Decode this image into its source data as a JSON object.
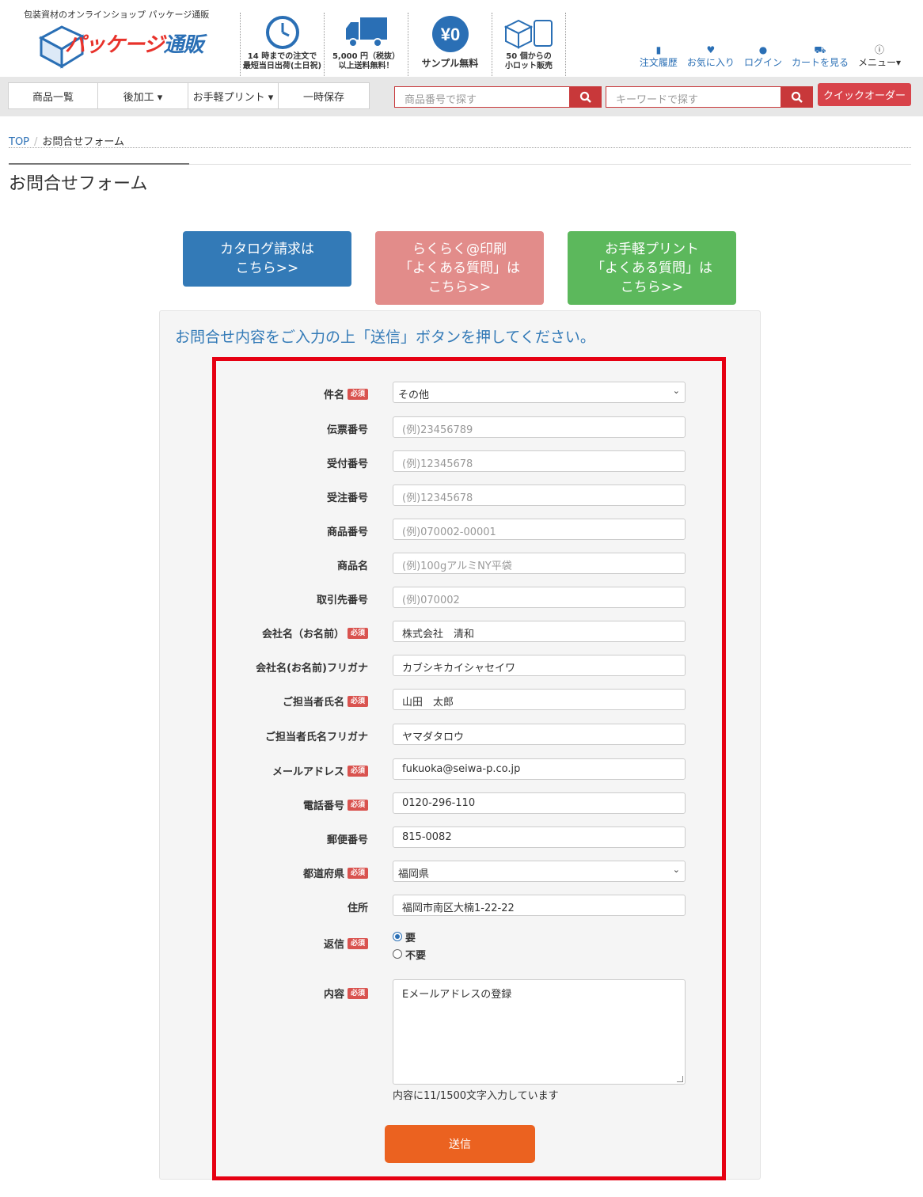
{
  "header": {
    "tagline": "包装資材のオンラインショップ パッケージ通販",
    "logo_text_a": "パッケージ",
    "logo_text_b": "通販",
    "features": [
      {
        "icon": "clock-icon",
        "caption_1": "14 時までの注文で",
        "caption_2": "最短当日出荷(土日祝)"
      },
      {
        "icon": "truck-icon",
        "caption_1": "5,000 円（税抜）",
        "caption_2": "以上送料無料！"
      },
      {
        "icon": "yen-zero-icon",
        "symbol": "¥0",
        "caption_1": "サンプル無料"
      },
      {
        "icon": "box-icon",
        "caption_1": "50 個からの",
        "caption_2": "小ロット販売"
      }
    ],
    "user_nav": [
      {
        "icon": "book-icon",
        "label": "注文履歴"
      },
      {
        "icon": "heart-icon",
        "label": "お気に入り"
      },
      {
        "icon": "user-icon",
        "label": "ログイン"
      },
      {
        "icon": "cart-icon",
        "label": "カートを見る"
      },
      {
        "icon": "info-icon",
        "label": "メニュー▾"
      }
    ]
  },
  "navbar": {
    "items": [
      "商品一覧",
      "後加工 ▾",
      "お手軽プリント ▾",
      "一時保存"
    ],
    "search_product_placeholder": "商品番号で探す",
    "search_keyword_placeholder": "キーワードで探す",
    "quick_order": "クイックオーダー"
  },
  "breadcrumb": {
    "home": "TOP",
    "current": "お問合せフォーム"
  },
  "page_title": "お問合せフォーム",
  "top_buttons": [
    {
      "line1": "カタログ請求は",
      "line2": "こちら>>"
    },
    {
      "line1": "らくらく@印刷",
      "line2": "「よくある質問」は",
      "line3": "こちら>>"
    },
    {
      "line1": "お手軽プリント",
      "line2": "「よくある質問」は",
      "line3": "こちら>>"
    }
  ],
  "form": {
    "lead": "お問合せ内容をご入力の上「送信」ボタンを押してください。",
    "required_badge": "必須",
    "fields": {
      "subject": {
        "label": "件名",
        "value": "その他"
      },
      "slip_no": {
        "label": "伝票番号",
        "placeholder": "(例)23456789"
      },
      "receipt_no": {
        "label": "受付番号",
        "placeholder": "(例)12345678"
      },
      "order_no": {
        "label": "受注番号",
        "placeholder": "(例)12345678"
      },
      "product_no": {
        "label": "商品番号",
        "placeholder": "(例)070002-00001"
      },
      "product_name": {
        "label": "商品名",
        "placeholder": "(例)100gアルミNY平袋"
      },
      "client_no": {
        "label": "取引先番号",
        "placeholder": "(例)070002"
      },
      "company": {
        "label": "会社名（お名前）",
        "value": "株式会社　清和"
      },
      "company_kana": {
        "label": "会社名(お名前)フリガナ",
        "value": "カブシキカイシャセイワ"
      },
      "contact": {
        "label": "ご担当者氏名",
        "value": "山田　太郎"
      },
      "contact_kana": {
        "label": "ご担当者氏名フリガナ",
        "value": "ヤマダタロウ"
      },
      "email": {
        "label": "メールアドレス",
        "value": "fukuoka@seiwa-p.co.jp"
      },
      "phone": {
        "label": "電話番号",
        "value": "0120-296-110"
      },
      "zip": {
        "label": "郵便番号",
        "value": "815-0082"
      },
      "prefecture": {
        "label": "都道府県",
        "value": "福岡県"
      },
      "address": {
        "label": "住所",
        "value": "福岡市南区大楠1-22-22"
      },
      "reply": {
        "label": "返信",
        "option_yes": "要",
        "option_no": "不要",
        "selected": "要"
      },
      "content": {
        "label": "内容",
        "value": "Eメールアドレスの登録"
      }
    },
    "counter": "内容に11/1500文字入力しています",
    "submit": "送信"
  },
  "colors": {
    "brand_blue": "#337ab7",
    "required_red": "#d9534f",
    "highlight_border": "#e60012",
    "submit_orange": "#eb6220"
  }
}
